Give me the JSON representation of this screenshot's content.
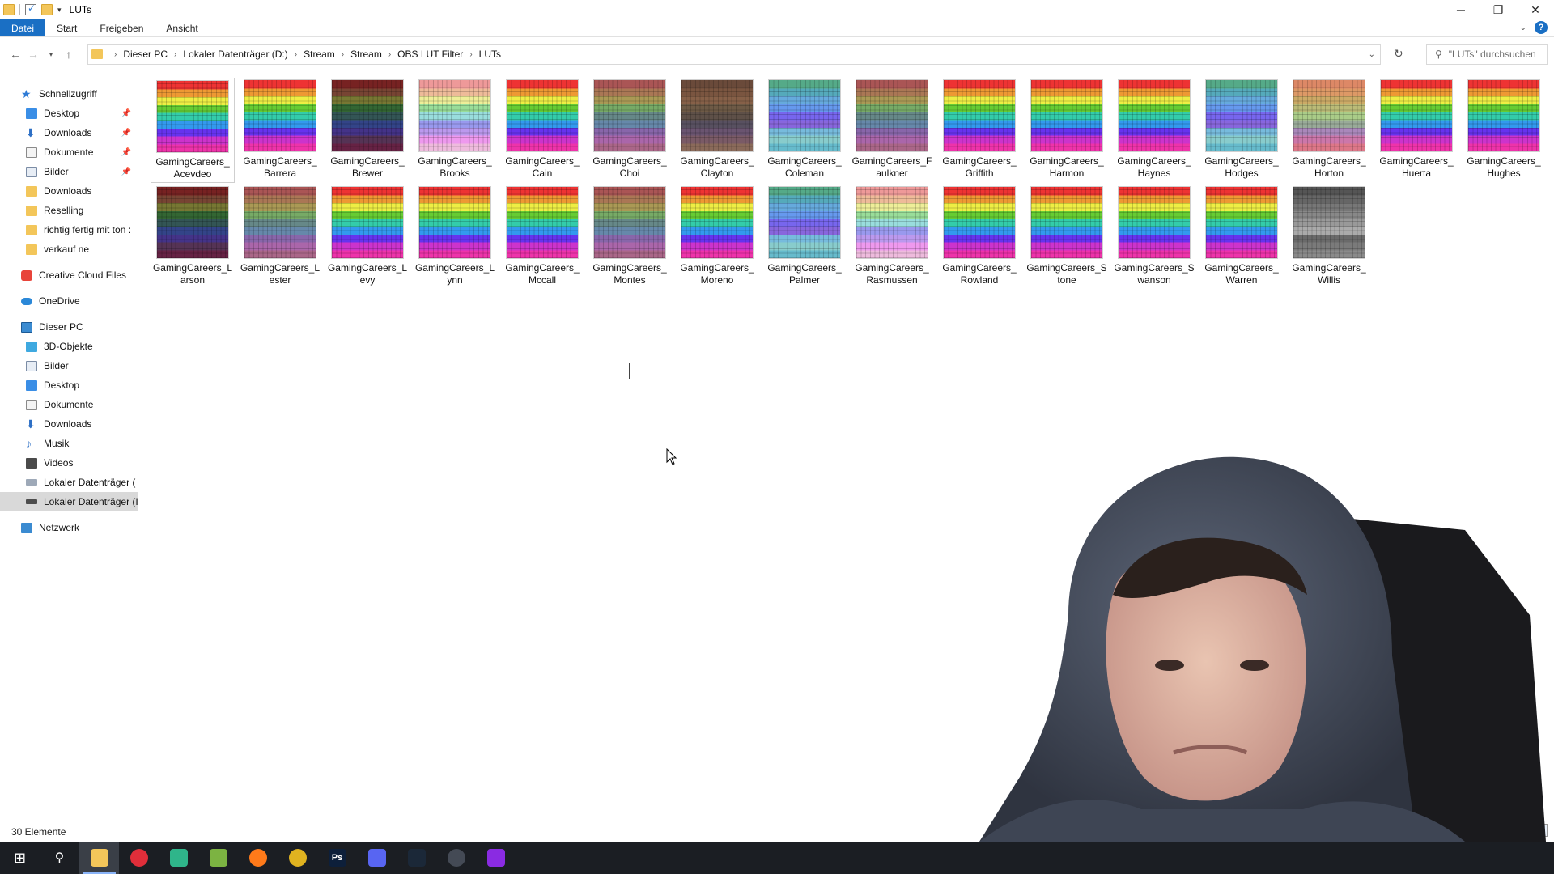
{
  "window": {
    "title": "LUTs"
  },
  "ribbon": {
    "tabs": [
      "Datei",
      "Start",
      "Freigeben",
      "Ansicht"
    ]
  },
  "address": {
    "crumbs": [
      "Dieser PC",
      "Lokaler Datenträger (D:)",
      "Stream",
      "Stream",
      "OBS LUT Filter",
      "LUTs"
    ]
  },
  "search": {
    "placeholder": "\"LUTs\" durchsuchen"
  },
  "sidebar": {
    "quick_access": "Schnellzugriff",
    "quick_items": [
      "Desktop",
      "Downloads",
      "Dokumente",
      "Bilder",
      "Downloads",
      "Reselling",
      "richtig fertig mit ton :",
      "verkauf ne"
    ],
    "creative_cloud": "Creative Cloud Files",
    "onedrive": "OneDrive",
    "this_pc": "Dieser PC",
    "pc_items": [
      "3D-Objekte",
      "Bilder",
      "Desktop",
      "Dokumente",
      "Downloads",
      "Musik",
      "Videos",
      "Lokaler Datenträger (",
      "Lokaler Datenträger (I"
    ],
    "network": "Netzwerk"
  },
  "files": [
    {
      "name": "GamingCareers_ Acevdeo",
      "tone": "bright"
    },
    {
      "name": "GamingCareers_ Barrera",
      "tone": "bright"
    },
    {
      "name": "GamingCareers_ Brewer",
      "tone": "dark"
    },
    {
      "name": "GamingCareers_ Brooks",
      "tone": "pastel"
    },
    {
      "name": "GamingCareers_ Cain",
      "tone": "bright"
    },
    {
      "name": "GamingCareers_ Choi",
      "tone": "muted"
    },
    {
      "name": "GamingCareers_ Clayton",
      "tone": "brown"
    },
    {
      "name": "GamingCareers_ Coleman",
      "tone": "cool"
    },
    {
      "name": "GamingCareers_F aulkner",
      "tone": "muted"
    },
    {
      "name": "GamingCareers_ Griffith",
      "tone": "bright"
    },
    {
      "name": "GamingCareers_ Harmon",
      "tone": "bright"
    },
    {
      "name": "GamingCareers_ Haynes",
      "tone": "bright"
    },
    {
      "name": "GamingCareers_ Hodges",
      "tone": "cool"
    },
    {
      "name": "GamingCareers_ Horton",
      "tone": "warm"
    },
    {
      "name": "GamingCareers_ Huerta",
      "tone": "bright"
    },
    {
      "name": "GamingCareers_ Hughes",
      "tone": "bright"
    },
    {
      "name": "GamingCareers_L arson",
      "tone": "dark"
    },
    {
      "name": "GamingCareers_L ester",
      "tone": "muted"
    },
    {
      "name": "GamingCareers_L evy",
      "tone": "bright"
    },
    {
      "name": "GamingCareers_L ynn",
      "tone": "bright"
    },
    {
      "name": "GamingCareers_ Mccall",
      "tone": "bright"
    },
    {
      "name": "GamingCareers_ Montes",
      "tone": "muted"
    },
    {
      "name": "GamingCareers_ Moreno",
      "tone": "bright"
    },
    {
      "name": "GamingCareers_ Palmer",
      "tone": "cool"
    },
    {
      "name": "GamingCareers_ Rasmussen",
      "tone": "pastel"
    },
    {
      "name": "GamingCareers_ Rowland",
      "tone": "bright"
    },
    {
      "name": "GamingCareers_S tone",
      "tone": "bright"
    },
    {
      "name": "GamingCareers_S wanson",
      "tone": "bright"
    },
    {
      "name": "GamingCareers_ Warren",
      "tone": "bright"
    },
    {
      "name": "GamingCareers_ Willis",
      "tone": "gray"
    }
  ],
  "status": {
    "count": "30 Elemente"
  },
  "taskbar": {
    "apps": [
      {
        "name": "start-icon",
        "color": "#1b1e23"
      },
      {
        "name": "search-icon",
        "color": "#1b1e23"
      },
      {
        "name": "file-explorer-icon",
        "color": "#f3c65a"
      },
      {
        "name": "opera-gx-icon",
        "color": "#e02e3a"
      },
      {
        "name": "app-icon-green",
        "color": "#2fb58a"
      },
      {
        "name": "app-icon-layers",
        "color": "#7cb342"
      },
      {
        "name": "firefox-icon",
        "color": "#ff7a1a"
      },
      {
        "name": "chrome-icon",
        "color": "#e0b320"
      },
      {
        "name": "photoshop-icon",
        "color": "#0d1f3a"
      },
      {
        "name": "discord-icon",
        "color": "#5865f2"
      },
      {
        "name": "steam-icon",
        "color": "#1b2838"
      },
      {
        "name": "davinci-resolve-icon",
        "color": "#444a55"
      },
      {
        "name": "winrar-icon",
        "color": "#8a2be2"
      }
    ],
    "labels": {
      "photoshop-icon": "Ps"
    }
  }
}
